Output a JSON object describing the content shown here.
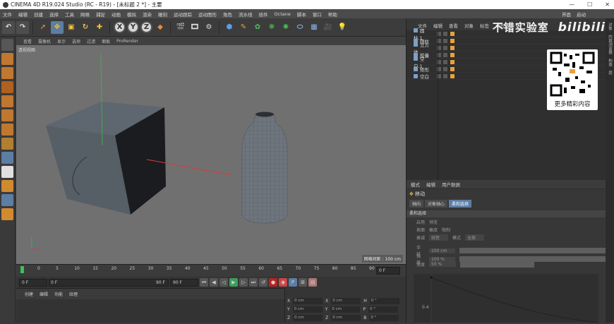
{
  "window": {
    "title": "CINEMA 4D R19.024 Studio (RC - R19) - [未标题 2 *] - 主要"
  },
  "menubar": {
    "items": [
      "文件",
      "编辑",
      "创建",
      "选择",
      "工具",
      "网格",
      "捕捉",
      "动画",
      "模拟",
      "渲染",
      "雕刻",
      "运动跟踪",
      "运动图形",
      "角色",
      "流水线",
      "插件",
      "Octane",
      "脚本",
      "窗口",
      "帮助"
    ],
    "right": [
      "界面",
      "启动"
    ]
  },
  "toolbar": {
    "axes": [
      "X",
      "Y",
      "Z"
    ]
  },
  "viewport": {
    "menu": [
      "查看",
      "摄像机",
      "显示",
      "选项",
      "过滤",
      "面板",
      "ProRender"
    ],
    "label": "透视视图",
    "grid": "网格间距 : 100 cm"
  },
  "timeline": {
    "ticks": [
      "0",
      "5",
      "10",
      "15",
      "20",
      "25",
      "30",
      "35",
      "40",
      "45",
      "50",
      "55",
      "60",
      "65",
      "70",
      "75",
      "80",
      "85",
      "90"
    ],
    "end": "0 F"
  },
  "playbar": {
    "start": "0 F",
    "cur": "0 F",
    "max": "90 F",
    "max2": "90 F"
  },
  "material": {
    "menu": [
      "创建",
      "编辑",
      "功能",
      "纹理"
    ]
  },
  "coords": {
    "rows": [
      [
        "X",
        "0 cm",
        "X",
        "0 cm",
        "H",
        "0 °"
      ],
      [
        "Y",
        "0 cm",
        "Y",
        "0 cm",
        "P",
        "0 °"
      ],
      [
        "Z",
        "0 cm",
        "Z",
        "0 cm",
        "B",
        "0 °"
      ]
    ]
  },
  "objects": {
    "menu": [
      "文件",
      "编辑",
      "查看",
      "对象",
      "标签",
      "书签"
    ],
    "items": [
      "圆柱.1",
      "圆柱",
      "立方体",
      "胶囊",
      "空白.1",
      "矩形",
      "空白"
    ]
  },
  "attributes": {
    "menu": [
      "模式",
      "编辑",
      "用户数据"
    ],
    "title": "移动",
    "tabs": [
      "轴向",
      "对象轴心",
      "柔和选择"
    ],
    "section": "柔和选择",
    "rows": [
      {
        "a": "启用",
        "b": "预览"
      },
      {
        "a": "表面",
        "b": "橡皮",
        "c": "限制"
      },
      {
        "a": "衰减",
        "v": "线性",
        "b": "模式",
        "v2": "全部"
      }
    ],
    "sliders": [
      {
        "label": "半径",
        "val": "100 cm"
      },
      {
        "label": "强度",
        "val": "100 %"
      },
      {
        "label": "宽度",
        "val": "50 %"
      }
    ],
    "graph_tick": "0.4"
  },
  "side_tabs": [
    "对象",
    "内容浏览器",
    "构造",
    "层"
  ],
  "watermark": {
    "text": "不错实验室",
    "brand": "bilibili",
    "qr_caption": "更多精彩内容"
  }
}
